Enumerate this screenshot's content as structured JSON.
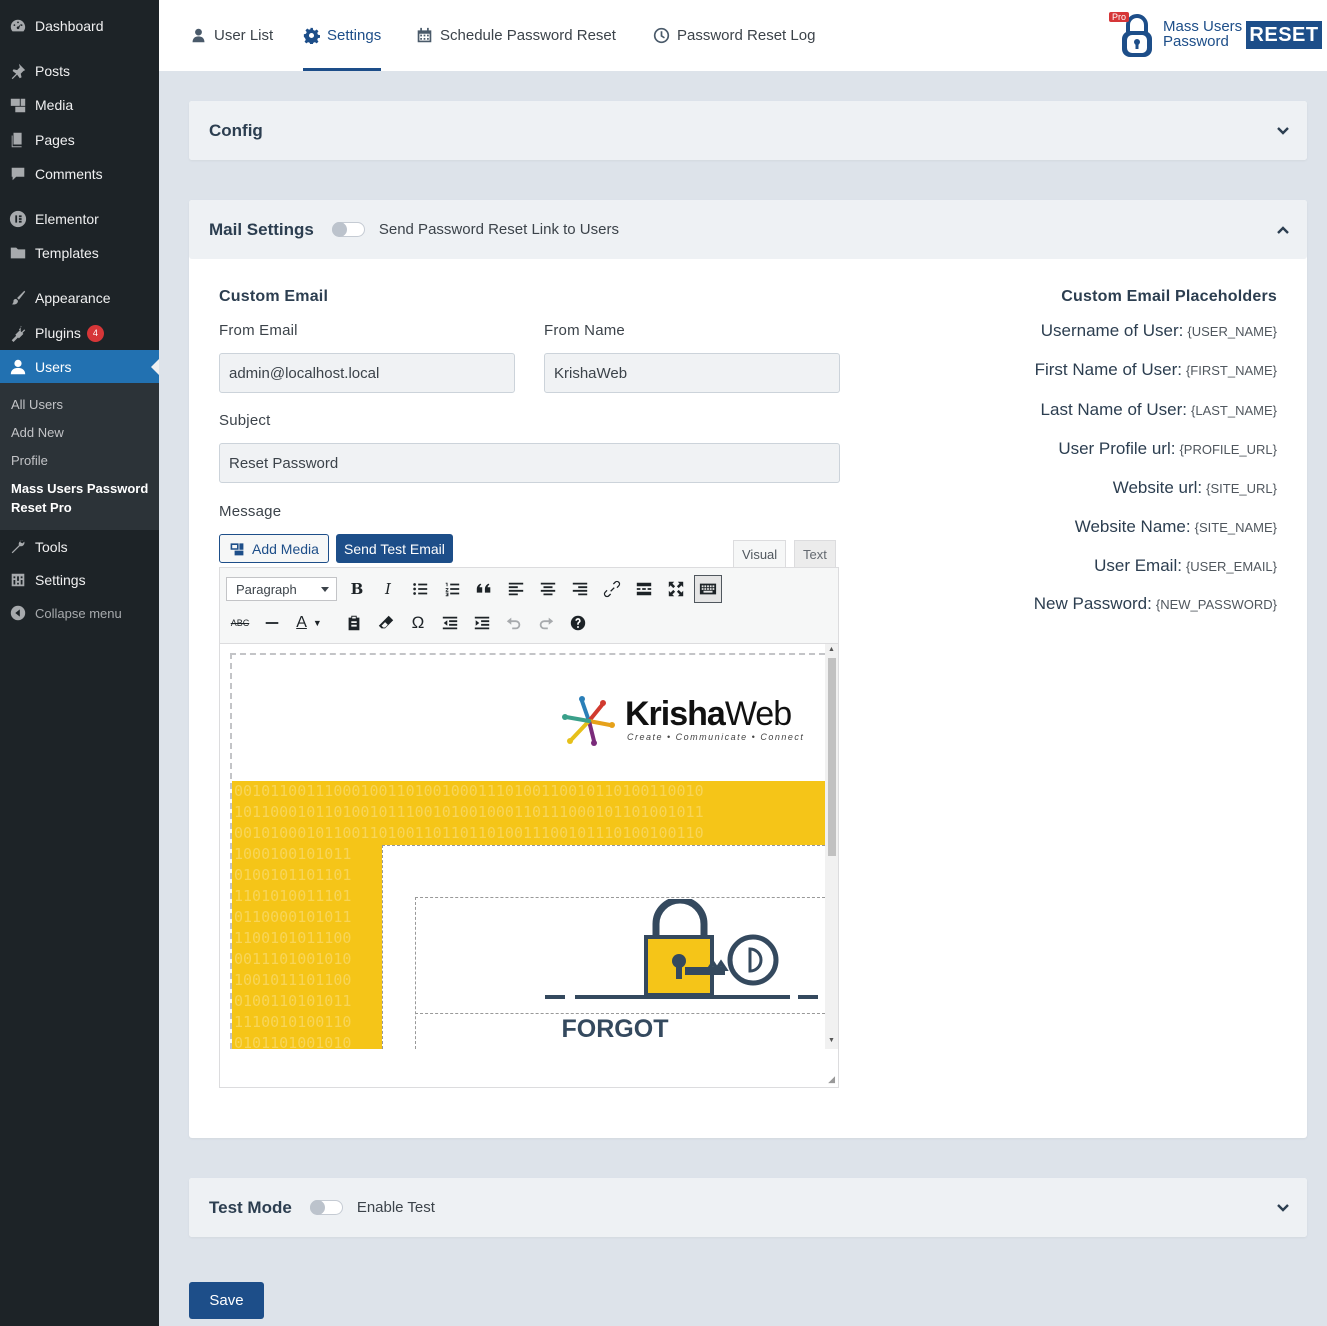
{
  "sidebar": {
    "items": [
      {
        "label": "Dashboard"
      },
      {
        "label": "Posts"
      },
      {
        "label": "Media"
      },
      {
        "label": "Pages"
      },
      {
        "label": "Comments"
      },
      {
        "label": "Elementor"
      },
      {
        "label": "Templates"
      },
      {
        "label": "Appearance"
      },
      {
        "label": "Plugins",
        "badge": "4"
      },
      {
        "label": "Users"
      },
      {
        "label": "Tools"
      },
      {
        "label": "Settings"
      }
    ],
    "submenu": [
      {
        "label": "All Users"
      },
      {
        "label": "Add New"
      },
      {
        "label": "Profile"
      },
      {
        "label": "Mass Users Password Reset Pro"
      }
    ],
    "collapse_label": "Collapse menu"
  },
  "tabs": [
    {
      "label": "User List",
      "icon": "user-icon"
    },
    {
      "label": "Settings",
      "icon": "gear-icon"
    },
    {
      "label": "Schedule Password Reset",
      "icon": "calendar-icon"
    },
    {
      "label": "Password Reset Log",
      "icon": "clock-icon"
    }
  ],
  "logo": {
    "pro": "Pro",
    "line1": "Mass Users",
    "line2": "Password",
    "reset": "RESET"
  },
  "config": {
    "title": "Config"
  },
  "mail": {
    "title": "Mail Settings",
    "toggle_label": "Send Password Reset Link to Users",
    "custom_email_heading": "Custom Email",
    "from_email_label": "From Email",
    "from_email_value": "admin@localhost.local",
    "from_name_label": "From Name",
    "from_name_value": "KrishaWeb",
    "subject_label": "Subject",
    "subject_value": "Reset Password",
    "message_label": "Message",
    "add_media": "Add Media",
    "send_test": "Send Test Email",
    "tab_visual": "Visual",
    "tab_text": "Text",
    "format": "Paragraph",
    "email_preview": {
      "brand_a": "Krisha",
      "brand_b": "Web",
      "tagline": "Create • Communicate • Connect",
      "heading": "FORGOT"
    }
  },
  "placeholders": {
    "heading": "Custom Email Placeholders",
    "rows": [
      {
        "label": "Username of User:",
        "code": "{USER_NAME}"
      },
      {
        "label": "First Name of User:",
        "code": "{FIRST_NAME}"
      },
      {
        "label": "Last Name of User:",
        "code": "{LAST_NAME}"
      },
      {
        "label": "User Profile url:",
        "code": "{PROFILE_URL}"
      },
      {
        "label": "Website url:",
        "code": "{SITE_URL}"
      },
      {
        "label": "Website Name:",
        "code": "{SITE_NAME}"
      },
      {
        "label": "User Email:",
        "code": "{USER_EMAIL}"
      },
      {
        "label": "New Password:",
        "code": "{NEW_PASSWORD}"
      }
    ]
  },
  "test_mode": {
    "title": "Test Mode",
    "toggle_label": "Enable Test"
  },
  "save_label": "Save",
  "colors": {
    "accent": "#1d4e89",
    "sidebar": "#1d2327",
    "active_menu": "#2271b1",
    "yellow": "#f5c518"
  }
}
